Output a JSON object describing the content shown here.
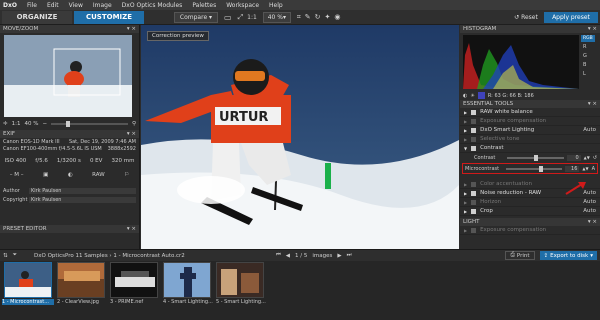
{
  "menubar": {
    "logo": "DxO",
    "items": [
      "File",
      "Edit",
      "View",
      "Image",
      "DxO Optics Modules",
      "Palettes",
      "Workspace",
      "Help"
    ]
  },
  "toolbar": {
    "organize": "ORGANIZE",
    "customize": "CUSTOMIZE",
    "compare": "Compare",
    "zoom": "40 %",
    "reset": "Reset",
    "apply_preset": "Apply preset"
  },
  "left": {
    "move_zoom": "MOVE/ZOOM",
    "zoom_value": "40 %",
    "exif": "EXIF",
    "exif_rows": [
      {
        "a": "Canon EOS-1D Mark III",
        "b": "Sat, Dec 19, 2009 7:46 AM"
      },
      {
        "a": "Canon EF100-400mm f/4.5-5.6L IS USM",
        "b": "3888x2592"
      }
    ],
    "exif_vals": [
      "ISO 400",
      "f/5.6",
      "1/3200 s",
      "0 EV",
      "320 mm"
    ],
    "exif_vals2": [
      "– M –",
      "",
      "",
      "RAW",
      ""
    ],
    "author_label": "Author",
    "author": "Kirk Paulsen",
    "copyright_label": "Copyright",
    "copyright": "Kirk Paulsen",
    "preset_editor": "PRESET EDITOR"
  },
  "center": {
    "correction_preview": "Correction preview"
  },
  "right": {
    "histogram": "HISTOGRAM",
    "channels": [
      "RGB",
      "R",
      "G",
      "B",
      "L"
    ],
    "hist_readout": "R: 63 G: 66 B: 186",
    "essential_tools": "ESSENTIAL TOOLS",
    "tools": [
      {
        "label": "RAW white balance",
        "dim": false,
        "val": ""
      },
      {
        "label": "Exposure compensation",
        "dim": true,
        "val": ""
      },
      {
        "label": "DxO Smart Lighting",
        "dim": false,
        "val": "Auto"
      },
      {
        "label": "Selective tone",
        "dim": true,
        "val": ""
      },
      {
        "label": "Contrast",
        "dim": false,
        "val": ""
      }
    ],
    "contrast_label": "Contrast",
    "contrast_val": "0",
    "microcontrast_label": "Microcontrast",
    "microcontrast_val": "16",
    "tools2": [
      {
        "label": "Color accentuation",
        "dim": true,
        "val": ""
      },
      {
        "label": "Noise reduction - RAW",
        "dim": false,
        "val": "Auto"
      },
      {
        "label": "Horizon",
        "dim": true,
        "val": "Auto"
      },
      {
        "label": "Crop",
        "dim": false,
        "val": "Auto"
      }
    ],
    "light": "LIGHT",
    "light_item": "Exposure compensation"
  },
  "bottom": {
    "breadcrumb": "DxO OpticsPro 11 Samples › 1 - Microcontrast Auto.cr2",
    "page": "1 / 5",
    "images": "images",
    "print": "Print",
    "export": "Export to disk",
    "thumbs": [
      "1 - Microcontrast...",
      "2 - ClearView.jpg",
      "3 - PRIME.nef",
      "4 - Smart Lighting...",
      "5 - Smart Lighting..."
    ]
  },
  "colors": {
    "accent": "#1f6ea8",
    "highlight": "#d01a1a",
    "jersey": "#e0401a"
  }
}
